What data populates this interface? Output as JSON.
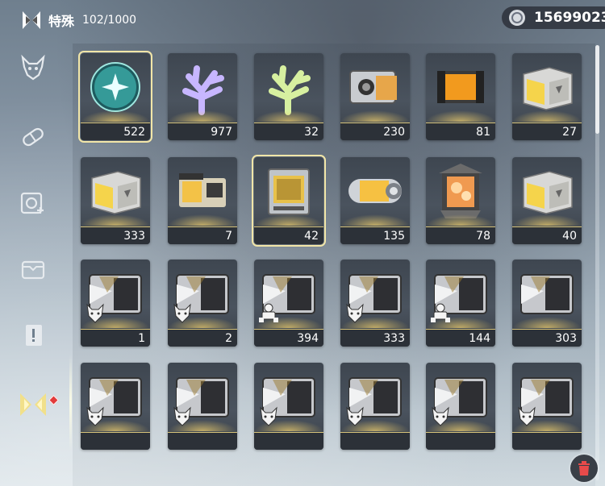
{
  "header": {
    "title": "特殊",
    "count": "102/1000"
  },
  "currency": {
    "amount": "15699023",
    "icon": "coin-icon"
  },
  "sidebar": {
    "items": [
      {
        "icon": "demon-mask-icon",
        "active": false
      },
      {
        "icon": "pill-capsule-icon",
        "active": false
      },
      {
        "icon": "module-plus-icon",
        "active": false
      },
      {
        "icon": "crate-icon",
        "active": false
      },
      {
        "icon": "alert-document-icon",
        "active": false
      },
      {
        "icon": "special-hourglass-icon",
        "active": true,
        "notification": true
      }
    ]
  },
  "items": [
    {
      "name": "orb",
      "qty": "522",
      "kind": "orb",
      "selected": true
    },
    {
      "name": "coral-rainbow",
      "qty": "977",
      "kind": "coral",
      "color": "#c7b6ff"
    },
    {
      "name": "coral-gold",
      "qty": "32",
      "kind": "coral",
      "color": "#d7f0a0"
    },
    {
      "name": "tech-crate",
      "qty": "230",
      "kind": "techcrate"
    },
    {
      "name": "orange-canister",
      "qty": "81",
      "kind": "canister"
    },
    {
      "name": "gold-box",
      "qty": "27",
      "kind": "goldbox"
    },
    {
      "name": "gold-box",
      "qty": "333",
      "kind": "goldbox"
    },
    {
      "name": "yellow-device",
      "qty": "7",
      "kind": "device"
    },
    {
      "name": "printer",
      "qty": "42",
      "kind": "printer",
      "selected": true
    },
    {
      "name": "capsule",
      "qty": "135",
      "kind": "capsule"
    },
    {
      "name": "lantern",
      "qty": "78",
      "kind": "lantern"
    },
    {
      "name": "gold-box",
      "qty": "40",
      "kind": "goldbox"
    },
    {
      "name": "silver-crate",
      "qty": "1",
      "kind": "silvercrate",
      "badge": "wolf"
    },
    {
      "name": "silver-crate",
      "qty": "2",
      "kind": "silvercrate",
      "badge": "wolf"
    },
    {
      "name": "silver-crate",
      "qty": "394",
      "kind": "silvercrate",
      "badge": "mech"
    },
    {
      "name": "silver-crate",
      "qty": "333",
      "kind": "silvercrate",
      "badge": "wolf"
    },
    {
      "name": "silver-crate",
      "qty": "144",
      "kind": "silvercrate",
      "badge": "mech"
    },
    {
      "name": "silver-crate",
      "qty": "303",
      "kind": "silvercrate",
      "badge": "none"
    },
    {
      "name": "silver-crate",
      "qty": "",
      "kind": "silvercrate",
      "badge": "wolf"
    },
    {
      "name": "silver-crate",
      "qty": "",
      "kind": "silvercrate",
      "badge": "wolf"
    },
    {
      "name": "silver-crate",
      "qty": "",
      "kind": "silvercrate",
      "badge": "wolf"
    },
    {
      "name": "silver-crate",
      "qty": "",
      "kind": "silvercrate",
      "badge": "wolf"
    },
    {
      "name": "silver-crate",
      "qty": "",
      "kind": "silvercrate",
      "badge": "wolf"
    },
    {
      "name": "silver-crate",
      "qty": "",
      "kind": "silvercrate",
      "badge": "wolf"
    }
  ],
  "trash": {
    "icon": "trash-icon"
  },
  "colors": {
    "accent": "#d9c57a",
    "red": "#e23b3b"
  }
}
